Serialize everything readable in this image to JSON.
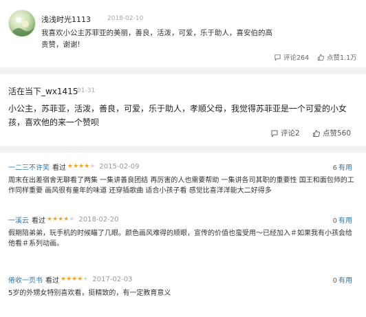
{
  "comment1": {
    "username": "浅浅时光1113",
    "date": "2018-02-10",
    "text": "我喜欢小公主苏菲亚的美丽，善良，活泼，可爱，乐于助人，喜安伯的高贵赞，谢谢!",
    "comments_label": "评论264",
    "likes_label": "点赞1.1万"
  },
  "comment2": {
    "username": "活在当下_wx1415",
    "date": "01-31",
    "text": "小公主，苏菲亚，活泼，善良，可爱，乐于助人，孝顺父母，我觉得苏菲亚是一个可爱的小女孩，喜欢他的来一个赞呗",
    "comments_label": "评论2",
    "likes_label": "点赞560"
  },
  "reviews": [
    {
      "author": "一二三不许笑",
      "seen_label": "看过",
      "rating": 4,
      "date": "2015-02-09",
      "useful_count": "6",
      "useful_label": "有用",
      "text": "周末在出差宿舍无聊看了两集 一集讲善良团结 再厉害的人也需要帮助 一集讲各司其职的重要性 国王和面包师的工作同样重要 画风很有童年的味道 还穿插歌曲 适合小孩子看 感觉比喜洋洋能大二好得多"
    },
    {
      "author": "一溪云",
      "seen_label": "看过",
      "rating": 4,
      "date": "2018-02-20",
      "useful_count": "0",
      "useful_label": "有用",
      "text": "假期陪弟弟，玩手机的时候瞄了几眼。颜色画风难得的顺眼，宣传的价值也蛮受用～已经加入＃如果我有小孩会给他看＃系列动画。"
    },
    {
      "author": "倦收一页书",
      "seen_label": "看过",
      "rating": 4,
      "date": "2017-02-03",
      "useful_count": "0",
      "useful_label": "有用",
      "text": "5岁的外甥女特别喜欢看，挺精致的，有一定教育意义"
    }
  ],
  "colors": {
    "link_blue": "#3377aa",
    "star_filled": "#f4a622",
    "star_empty": "#d8d8d8",
    "band_gray": "#f2f2f2"
  }
}
